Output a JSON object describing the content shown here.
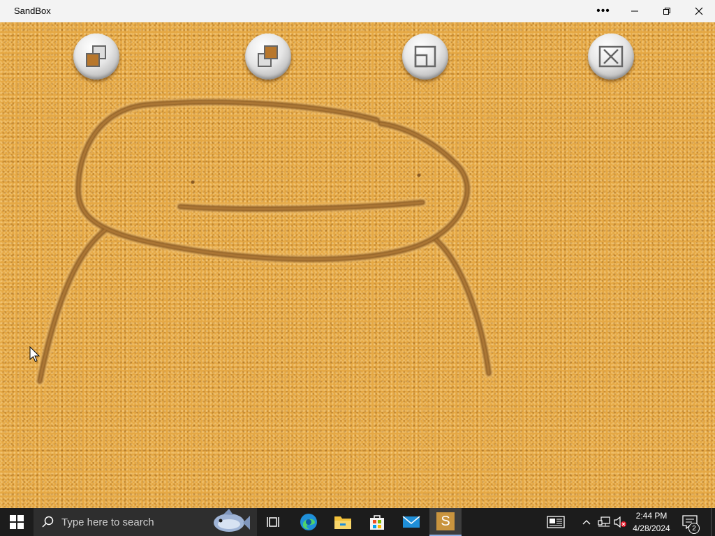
{
  "window": {
    "title": "SandBox",
    "controls": {
      "more": "more-icon",
      "minimize": "minimize-icon",
      "restore": "restore-icon",
      "close": "close-icon"
    }
  },
  "toolbar": {
    "buttons": [
      {
        "name": "layout-swap-button-1",
        "icon": "overlap-squares-icon"
      },
      {
        "name": "layout-swap-button-2",
        "icon": "overlap-squares-alt-icon"
      },
      {
        "name": "resize-button",
        "icon": "corner-square-icon"
      },
      {
        "name": "clear-button",
        "icon": "x-box-icon"
      }
    ]
  },
  "canvas": {
    "surface": "sand",
    "color": "#e5a844"
  },
  "taskbar": {
    "search_placeholder": "Type here to search",
    "clock_time": "2:44 PM",
    "clock_date": "4/28/2024",
    "notification_count": "2",
    "pinned": [
      "task-view-icon",
      "edge-icon",
      "file-explorer-icon",
      "store-icon",
      "mail-icon",
      "sandbox-app-icon"
    ],
    "active_app_letter": "S"
  }
}
